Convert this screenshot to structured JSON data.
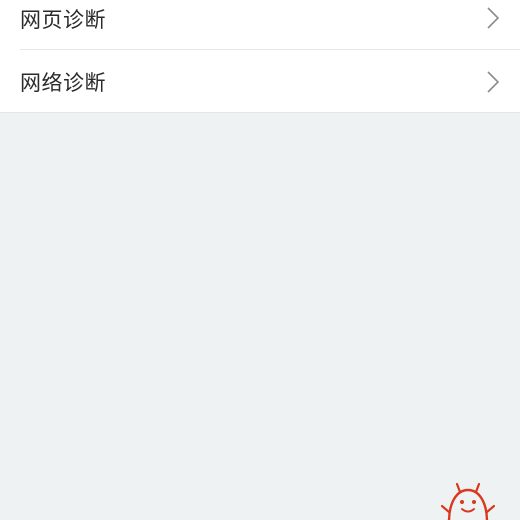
{
  "menu": {
    "items": [
      {
        "label": "网页诊断",
        "icon": "chevron-right-icon"
      },
      {
        "label": "网络诊断",
        "icon": "chevron-right-icon"
      }
    ]
  },
  "mascot": {
    "icon": "red-robot-mascot-icon",
    "color": "#d9381e"
  },
  "colors": {
    "background": "#eef2f3",
    "list_background": "#ffffff",
    "text": "#2b2b2b",
    "chevron": "#8c8c8c"
  }
}
